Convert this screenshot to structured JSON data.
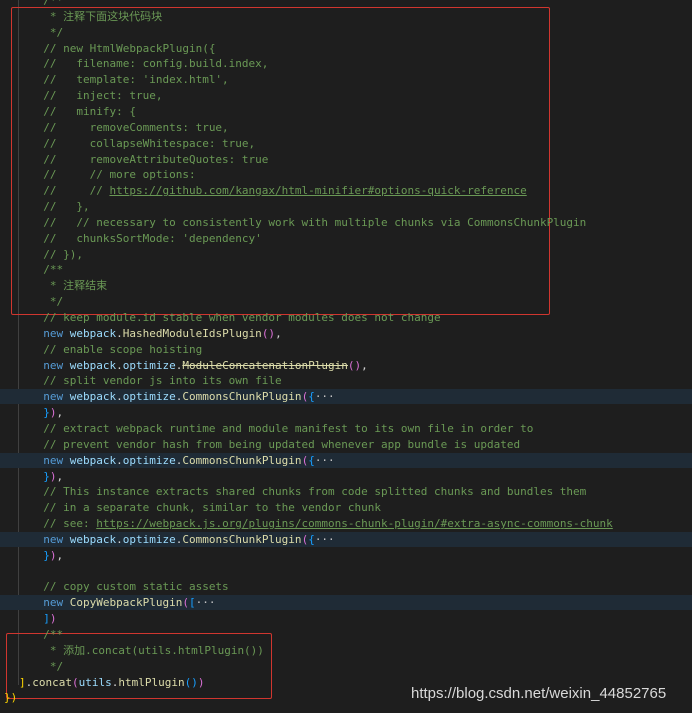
{
  "editor": {
    "lines": [
      {
        "indent": "  ",
        "spans": [
          {
            "text": "/**",
            "cls": "c"
          }
        ]
      },
      {
        "indent": "   ",
        "spans": [
          {
            "text": "* 注释下面这块代码块",
            "cls": "c"
          }
        ]
      },
      {
        "indent": "   ",
        "spans": [
          {
            "text": "*/",
            "cls": "c"
          }
        ]
      },
      {
        "indent": "  ",
        "spans": [
          {
            "text": "// new HtmlWebpackPlugin({",
            "cls": "c"
          }
        ]
      },
      {
        "indent": "  ",
        "spans": [
          {
            "text": "//   filename: config.build.index,",
            "cls": "c"
          }
        ]
      },
      {
        "indent": "  ",
        "spans": [
          {
            "text": "//   template: 'index.html',",
            "cls": "c"
          }
        ]
      },
      {
        "indent": "  ",
        "spans": [
          {
            "text": "//   inject: true,",
            "cls": "c"
          }
        ]
      },
      {
        "indent": "  ",
        "spans": [
          {
            "text": "//   minify: {",
            "cls": "c"
          }
        ]
      },
      {
        "indent": "  ",
        "spans": [
          {
            "text": "//     removeComments: true,",
            "cls": "c"
          }
        ]
      },
      {
        "indent": "  ",
        "spans": [
          {
            "text": "//     collapseWhitespace: true,",
            "cls": "c"
          }
        ]
      },
      {
        "indent": "  ",
        "spans": [
          {
            "text": "//     removeAttributeQuotes: true",
            "cls": "c"
          }
        ]
      },
      {
        "indent": "  ",
        "spans": [
          {
            "text": "//     // more options:",
            "cls": "c"
          }
        ]
      },
      {
        "indent": "  ",
        "spans": [
          {
            "text": "//     // ",
            "cls": "c"
          },
          {
            "text": "https://github.com/kangax/html-minifier#options-quick-reference",
            "cls": "c u"
          }
        ]
      },
      {
        "indent": "  ",
        "spans": [
          {
            "text": "//   },",
            "cls": "c"
          }
        ]
      },
      {
        "indent": "  ",
        "spans": [
          {
            "text": "//   // necessary to consistently work with multiple chunks via CommonsChunkPlugin",
            "cls": "c"
          }
        ]
      },
      {
        "indent": "  ",
        "spans": [
          {
            "text": "//   chunksSortMode: 'dependency'",
            "cls": "c"
          }
        ]
      },
      {
        "indent": "  ",
        "spans": [
          {
            "text": "// }),",
            "cls": "c"
          }
        ]
      },
      {
        "indent": "  ",
        "spans": [
          {
            "text": "/**",
            "cls": "c"
          }
        ]
      },
      {
        "indent": "   ",
        "spans": [
          {
            "text": "* 注释结束",
            "cls": "c"
          }
        ]
      },
      {
        "indent": "   ",
        "spans": [
          {
            "text": "*/",
            "cls": "c"
          }
        ]
      },
      {
        "indent": "  ",
        "spans": [
          {
            "text": "// keep module.id stable when vendor modules does not change",
            "cls": "c"
          }
        ]
      },
      {
        "indent": "  ",
        "spans": [
          {
            "text": "new ",
            "cls": "k"
          },
          {
            "text": "webpack",
            "cls": "v"
          },
          {
            "text": ".",
            "cls": "t"
          },
          {
            "text": "HashedModuleIdsPlugin",
            "cls": "f"
          },
          {
            "text": "()",
            "cls": "p"
          },
          {
            "text": ",",
            "cls": "t"
          }
        ]
      },
      {
        "indent": "  ",
        "spans": [
          {
            "text": "// enable scope hoisting",
            "cls": "c"
          }
        ]
      },
      {
        "indent": "  ",
        "spans": [
          {
            "text": "new ",
            "cls": "k"
          },
          {
            "text": "webpack",
            "cls": "v"
          },
          {
            "text": ".",
            "cls": "t"
          },
          {
            "text": "optimize",
            "cls": "v"
          },
          {
            "text": ".",
            "cls": "t"
          },
          {
            "text": "ModuleConcatenationPlugin",
            "cls": "f s"
          },
          {
            "text": "()",
            "cls": "p"
          },
          {
            "text": ",",
            "cls": "t"
          }
        ]
      },
      {
        "indent": "  ",
        "spans": [
          {
            "text": "// split vendor js into its own file",
            "cls": "c"
          }
        ]
      },
      {
        "indent": "  ",
        "hl": true,
        "spans": [
          {
            "text": "new ",
            "cls": "k"
          },
          {
            "text": "webpack",
            "cls": "v"
          },
          {
            "text": ".",
            "cls": "t"
          },
          {
            "text": "optimize",
            "cls": "v"
          },
          {
            "text": ".",
            "cls": "t"
          },
          {
            "text": "CommonsChunkPlugin",
            "cls": "f"
          },
          {
            "text": "(",
            "cls": "p"
          },
          {
            "text": "{",
            "cls": "b"
          },
          {
            "text": "···",
            "cls": "fold"
          }
        ]
      },
      {
        "indent": "  ",
        "spans": [
          {
            "text": "}",
            "cls": "b"
          },
          {
            "text": ")",
            "cls": "p"
          },
          {
            "text": ",",
            "cls": "t"
          }
        ]
      },
      {
        "indent": "  ",
        "spans": [
          {
            "text": "// extract webpack runtime and module manifest to its own file in order to",
            "cls": "c"
          }
        ]
      },
      {
        "indent": "  ",
        "spans": [
          {
            "text": "// prevent vendor hash from being updated whenever app bundle is updated",
            "cls": "c"
          }
        ]
      },
      {
        "indent": "  ",
        "hl": true,
        "spans": [
          {
            "text": "new ",
            "cls": "k"
          },
          {
            "text": "webpack",
            "cls": "v"
          },
          {
            "text": ".",
            "cls": "t"
          },
          {
            "text": "optimize",
            "cls": "v"
          },
          {
            "text": ".",
            "cls": "t"
          },
          {
            "text": "CommonsChunkPlugin",
            "cls": "f"
          },
          {
            "text": "(",
            "cls": "p"
          },
          {
            "text": "{",
            "cls": "b"
          },
          {
            "text": "···",
            "cls": "fold"
          }
        ]
      },
      {
        "indent": "  ",
        "spans": [
          {
            "text": "}",
            "cls": "b"
          },
          {
            "text": ")",
            "cls": "p"
          },
          {
            "text": ",",
            "cls": "t"
          }
        ]
      },
      {
        "indent": "  ",
        "spans": [
          {
            "text": "// This instance extracts shared chunks from code splitted chunks and bundles them",
            "cls": "c"
          }
        ]
      },
      {
        "indent": "  ",
        "spans": [
          {
            "text": "// in a separate chunk, similar to the vendor chunk",
            "cls": "c"
          }
        ]
      },
      {
        "indent": "  ",
        "spans": [
          {
            "text": "// see: ",
            "cls": "c"
          },
          {
            "text": "https://webpack.js.org/plugins/commons-chunk-plugin/#extra-async-commons-chunk",
            "cls": "c u"
          }
        ]
      },
      {
        "indent": "  ",
        "hl": true,
        "spans": [
          {
            "text": "new ",
            "cls": "k"
          },
          {
            "text": "webpack",
            "cls": "v"
          },
          {
            "text": ".",
            "cls": "t"
          },
          {
            "text": "optimize",
            "cls": "v"
          },
          {
            "text": ".",
            "cls": "t"
          },
          {
            "text": "CommonsChunkPlugin",
            "cls": "f"
          },
          {
            "text": "(",
            "cls": "p"
          },
          {
            "text": "{",
            "cls": "b"
          },
          {
            "text": "···",
            "cls": "fold"
          }
        ]
      },
      {
        "indent": "  ",
        "spans": [
          {
            "text": "}",
            "cls": "b"
          },
          {
            "text": ")",
            "cls": "p"
          },
          {
            "text": ",",
            "cls": "t"
          }
        ]
      },
      {
        "indent": "",
        "spans": []
      },
      {
        "indent": "  ",
        "spans": [
          {
            "text": "// copy custom static assets",
            "cls": "c"
          }
        ]
      },
      {
        "indent": "  ",
        "hl": true,
        "spans": [
          {
            "text": "new ",
            "cls": "k"
          },
          {
            "text": "CopyWebpackPlugin",
            "cls": "f"
          },
          {
            "text": "(",
            "cls": "p"
          },
          {
            "text": "[",
            "cls": "b"
          },
          {
            "text": "···",
            "cls": "fold"
          }
        ]
      },
      {
        "indent": "  ",
        "spans": [
          {
            "text": "]",
            "cls": "b"
          },
          {
            "text": ")",
            "cls": "p"
          }
        ]
      },
      {
        "indent": "  ",
        "spans": [
          {
            "text": "/**",
            "cls": "c"
          }
        ]
      },
      {
        "indent": "   ",
        "spans": [
          {
            "text": "* 添加.concat(utils.htmlPlugin())",
            "cls": "c"
          }
        ]
      },
      {
        "indent": "   ",
        "spans": [
          {
            "text": "*/",
            "cls": "c"
          }
        ]
      },
      {
        "indent": "",
        "spans": [
          {
            "text": "]",
            "cls": "y"
          },
          {
            "text": ".",
            "cls": "t"
          },
          {
            "text": "concat",
            "cls": "f"
          },
          {
            "text": "(",
            "cls": "p"
          },
          {
            "text": "utils",
            "cls": "v"
          },
          {
            "text": ".",
            "cls": "t"
          },
          {
            "text": "htmlPlugin",
            "cls": "f"
          },
          {
            "text": "()",
            "cls": "b"
          },
          {
            "text": ")",
            "cls": "p"
          }
        ]
      },
      {
        "indent": "",
        "spans": [
          {
            "text": "})",
            "cls": "y"
          }
        ]
      }
    ]
  },
  "watermark": {
    "text": "https://blog.csdn.net/weixin_44852765"
  },
  "colors": {
    "background": "#1e1e1e",
    "comment": "#6a9955",
    "keyword": "#569cd6",
    "annotation_box": "#d0362f"
  }
}
